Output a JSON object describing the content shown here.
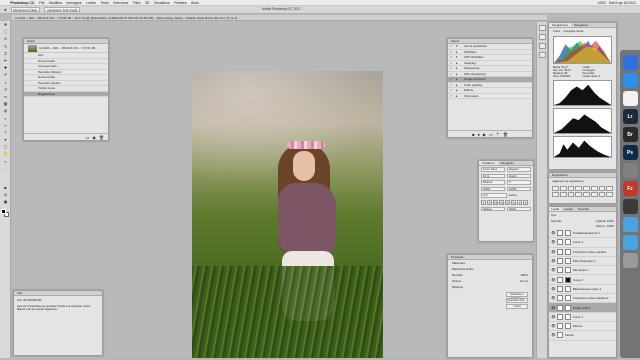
{
  "menubar": {
    "apple": "",
    "app_name": "Photoshop CC",
    "items": [
      "File",
      "Modifica",
      "Immagine",
      "Livello",
      "Testo",
      "Selezione",
      "Filtro",
      "3D",
      "Visualizza",
      "Finestra",
      "Aiuto"
    ],
    "clock": "Sab 8 apr 18:23:41",
    "status": [
      "100%"
    ]
  },
  "window_title": "Adobe Photoshop CC 2017",
  "options_bar": {
    "fields": [
      "Dimensioni: Fisse",
      "Campiona: Tutti i livelli"
    ]
  },
  "document_tab": "IL-0022 -- 4b0 -- 1B1C13-OC -- 7.8,7B-1B -- 18,7.7H-I@ [Brandwhite, CHROLOR I8 19% 0% 00-DA-85] -- [Retouching, Stars] -- Chiana, Wear Burns (R1-A1-r-1*) (1-1)",
  "toolbar": {
    "tools": [
      "move-icon",
      "marquee-icon",
      "lasso-icon",
      "quick-select-icon",
      "crop-icon",
      "eyedropper-icon",
      "heal-icon",
      "brush-icon",
      "stamp-icon",
      "history-brush-icon",
      "eraser-icon",
      "gradient-icon",
      "blur-icon",
      "dodge-icon",
      "pen-icon",
      "type-icon",
      "path-select-icon",
      "shape-icon",
      "hand-icon",
      "zoom-icon",
      "dots-icon",
      "swatches-icon",
      "mask-icon",
      "screen-icon"
    ]
  },
  "history": {
    "title": "Storia",
    "snapshot": "IL-0022 -- 4b0 -- 1B1C13-OC -- 7.8,7B-1B",
    "items": [
      "Apri",
      "Nuovo livello",
      "Crea pennello",
      "Pennello: Ritocco",
      "Nuovo livello",
      "Pennello: Dipinto",
      "Timbro clone",
      "Regolazione"
    ],
    "selected_index": 7
  },
  "info": {
    "title": "Info",
    "doc": "Doc: 65,4M/969,9M",
    "hint": "Fare clic e trascinare per spostare il livello o la selezione. Usare Maiusc e Alt per opzioni aggiuntive."
  },
  "actions": {
    "title": "Azioni",
    "items": [
      {
        "label": "Azioni predefinite",
        "expanded": true
      },
      {
        "label": "Workflow",
        "expanded": false
      },
      {
        "label": "GPF Workflow",
        "expanded": true
      },
      {
        "label": "Cleaning",
        "expanded": false
      },
      {
        "label": "Sharpening",
        "expanded": false
      },
      {
        "label": "Web sharpening",
        "expanded": false
      },
      {
        "label": "Dodge and burn",
        "expanded": false,
        "selected": true
      },
      {
        "label": "Color grading",
        "expanded": false
      },
      {
        "label": "Effects",
        "expanded": false
      },
      {
        "label": "Final steps",
        "expanded": false
      }
    ]
  },
  "character": {
    "tabs": [
      "Carattere",
      "Paragrafo"
    ],
    "font": "Tenor Sans",
    "style": "Regular",
    "size": "12 pt",
    "leading": "(Auto)",
    "kerning": "Metrica",
    "tracking": "0",
    "vscale": "100%",
    "hscale": "100%",
    "baseline": "0 pt",
    "color_label": "Colore:",
    "language": "Italiano",
    "aa": "Nitido",
    "style_buttons": [
      "T",
      "T",
      "TT",
      "Tt",
      "T¹",
      "T₁",
      "T",
      "T"
    ]
  },
  "properties": {
    "title": "Proprietà",
    "kind": "Maschere",
    "layer_mask_label": "Maschera livello",
    "density_label": "Densità:",
    "density_value": "100%",
    "feather_label": "Sfuma:",
    "feather_value": "0,0 px",
    "refine_label": "Migliora:",
    "buttons": [
      "Seleziona e maschera...",
      "Intervallo colori...",
      "Inverti"
    ]
  },
  "histogram": {
    "tabs": [
      "Istogramma",
      "Navigatore"
    ],
    "channel": "Colori",
    "source": "Immagine intera",
    "stats": [
      "Media: 94,27",
      "Livello:",
      "Dev. std.: 58,07",
      "Conteggio:",
      "Mediana: 88",
      "Percentile:",
      "Pixel: 1502500",
      "Livello cache: 4"
    ]
  },
  "adjustments": {
    "title": "Regolazioni",
    "subtitle": "Aggiungi una regolazione"
  },
  "layers": {
    "tabs": [
      "Livelli",
      "Canali",
      "Tracciati"
    ],
    "kind_label": "Tipo",
    "blend_mode": "Normale",
    "opacity": "Opacità: 100%",
    "fill": "Riemp.: 100%",
    "items": [
      {
        "name": "Tonalità/saturazione 1",
        "mask": "white"
      },
      {
        "name": "Curve 3",
        "mask": "white"
      },
      {
        "name": "Correzione colore selettiva",
        "mask": "white"
      },
      {
        "name": "Filtro fotografico 1",
        "mask": "white"
      },
      {
        "name": "Sfumatura 1",
        "mask": "white"
      },
      {
        "name": "Curve 2",
        "mask": "black"
      },
      {
        "name": "Bilanciamento colore 1",
        "mask": "white"
      },
      {
        "name": "Correzione colore selettiva 2",
        "mask": "white"
      },
      {
        "name": "Dodge & Burn",
        "mask": "white",
        "selected": true
      },
      {
        "name": "Curve 1",
        "mask": "white"
      },
      {
        "name": "Ritocco",
        "mask": "white"
      },
      {
        "name": "Sfondo",
        "mask": "none"
      }
    ]
  },
  "dock": [
    {
      "name": "finder-icon",
      "label": "",
      "color": "#2f6fe0"
    },
    {
      "name": "safari-icon",
      "label": "",
      "color": "#2d8fe6"
    },
    {
      "name": "chrome-icon",
      "label": "",
      "color": "#f2f2f2"
    },
    {
      "name": "lightroom-icon",
      "label": "Lr",
      "color": "#1c2b3a"
    },
    {
      "name": "bridge-icon",
      "label": "Br",
      "color": "#2a2a2a"
    },
    {
      "name": "photoshop-icon",
      "label": "Ps",
      "color": "#0e2a4a"
    },
    {
      "name": "system-prefs-icon",
      "label": "",
      "color": "#808080"
    },
    {
      "name": "filezilla-icon",
      "label": "Fz",
      "color": "#c0392b"
    },
    {
      "name": "terminal-icon",
      "label": "",
      "color": "#3a3a3a"
    },
    {
      "name": "folder-icon",
      "label": "",
      "color": "#4aa3e0"
    },
    {
      "name": "downloads-icon",
      "label": "",
      "color": "#4aa3e0"
    },
    {
      "name": "trash-icon",
      "label": "",
      "color": "#9a9a9a"
    }
  ]
}
